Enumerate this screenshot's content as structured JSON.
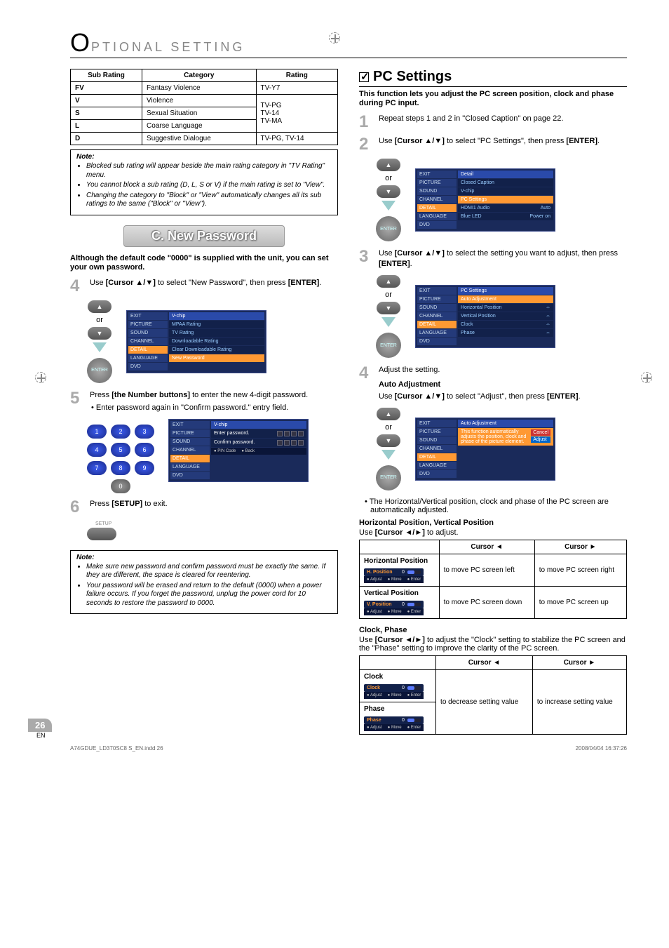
{
  "header": {
    "letter": "O",
    "rest": "PTIONAL SETTING"
  },
  "ratings_table": {
    "headers": [
      "Sub Rating",
      "Category",
      "Rating"
    ],
    "rows": [
      {
        "sub": "FV",
        "cat": "Fantasy Violence",
        "rating": "TV-Y7"
      },
      {
        "sub": "V",
        "cat": "Violence",
        "rating": "TV-PG\nTV-14\nTV-MA"
      },
      {
        "sub": "S",
        "cat": "Sexual Situation",
        "rating": ""
      },
      {
        "sub": "L",
        "cat": "Coarse Language",
        "rating": ""
      },
      {
        "sub": "D",
        "cat": "Suggestive Dialogue",
        "rating": "TV-PG, TV-14"
      }
    ]
  },
  "note1": {
    "title": "Note:",
    "items": [
      "Blocked sub rating will appear beside the main rating category in \"TV Rating\" menu.",
      "You cannot block a sub rating (D, L, S or V) if the main rating is set to \"View\".",
      "Changing the category to \"Block\" or \"View\" automatically changes all its sub ratings to the same (\"Block\" or \"View\")."
    ]
  },
  "banner_c": "C.  New Password",
  "pw_intro": "Although the default code \"0000\" is supplied with the unit, you can set your own password.",
  "step4": {
    "n": "4",
    "t1": "Use ",
    "bold": "[Cursor ▲/▼]",
    "t2": " to select \"New Password\", then press ",
    "bold2": "[ENTER]",
    "t3": "."
  },
  "or": "or",
  "enter": "ENTER",
  "osd_vchip": {
    "side": [
      "EXIT",
      "PICTURE",
      "SOUND",
      "CHANNEL",
      "DETAIL",
      "LANGUAGE",
      "DVD"
    ],
    "title": "V-chip",
    "rows": [
      "MPAA Rating",
      "TV Rating",
      "Downloadable Rating",
      "Clear Downloadable Rating",
      "New Password"
    ]
  },
  "step5": {
    "n": "5",
    "t1": "Press ",
    "bold": "[the Number buttons]",
    "t2": " to enter the new 4-digit password.",
    "sub": "Enter password again in \"Confirm password.\" entry field."
  },
  "osd_pw": {
    "title": "V-chip",
    "rows": [
      {
        "label": "Enter password."
      },
      {
        "label": "Confirm password."
      }
    ],
    "foot": [
      "PIN Code",
      "Back"
    ]
  },
  "step6": {
    "n": "6",
    "t1": "Press ",
    "bold": "[SETUP]",
    "t2": " to exit."
  },
  "setup_lbl": "SETUP",
  "note2": {
    "title": "Note:",
    "items": [
      "Make sure new password and confirm password must be exactly the same. If they are different, the space is cleared for reentering.",
      "Your password will be erased and return to the default (0000) when a power failure occurs. If you forget the password, unplug the power cord for 10 seconds to restore the password to 0000."
    ]
  },
  "pc": {
    "title": "PC Settings",
    "intro": "This function lets you adjust the PC screen position, clock and phase during PC input.",
    "s1": {
      "n": "1",
      "t": "Repeat steps 1 and 2 in \"Closed Caption\" on page 22."
    },
    "s2": {
      "n": "2",
      "t1": "Use ",
      "bold": "[Cursor ▲/▼]",
      "t2": " to select \"PC Settings\", then press ",
      "bold2": "[ENTER]",
      "t3": "."
    },
    "osd_detail": {
      "title": "Detail",
      "rows": [
        {
          "l": "Closed Caption",
          "r": ""
        },
        {
          "l": "V-chip",
          "r": ""
        },
        {
          "l": "PC Settings",
          "r": "",
          "hi": true
        },
        {
          "l": "HDMI1 Audio",
          "r": "Auto"
        },
        {
          "l": "Blue LED",
          "r": "Power on"
        }
      ]
    },
    "s3": {
      "n": "3",
      "t1": "Use ",
      "bold": "[Cursor ▲/▼]",
      "t2": " to select the setting you want to adjust, then press ",
      "bold2": "[ENTER]",
      "t3": "."
    },
    "osd_pcs": {
      "title": "PC Settings",
      "rows": [
        {
          "l": "Auto Adjustment",
          "r": "",
          "hi": true
        },
        {
          "l": "Horizontal Position",
          "r": "⇔"
        },
        {
          "l": "Vertical Position",
          "r": "⇔"
        },
        {
          "l": "Clock",
          "r": "⇔"
        },
        {
          "l": "Phase",
          "r": "⇔"
        }
      ]
    },
    "s4": {
      "n": "4",
      "t": "Adjust the setting.",
      "auto_h": "Auto Adjustment",
      "auto_t1": "Use ",
      "auto_b": "[Cursor ▲/▼]",
      "auto_t2": " to select \"Adjust\", then press ",
      "auto_b2": "[ENTER]",
      "auto_t3": "."
    },
    "osd_auto": {
      "title": "Auto Adjustment",
      "desc": "This function automatically adjusts the position, clock and phase of the picture element.",
      "opts": [
        "Cancel",
        "Adjust"
      ]
    },
    "auto_bullet": "The Horizontal/Vertical position, clock and phase of the PC screen are automatically adjusted.",
    "hv_h": "Horizontal Position, Vertical Position",
    "hv_t1": "Use ",
    "hv_b": "[Cursor ◄/►]",
    "hv_t2": " to adjust.",
    "tbl_hv": {
      "head": [
        "",
        "Cursor ◄",
        "Cursor ►"
      ],
      "r1": {
        "title": "Horizontal Position",
        "lab": "H. Position",
        "c1": "to move PC screen left",
        "c2": "to move PC screen right"
      },
      "r2": {
        "title": "Vertical Position",
        "lab": "V. Position",
        "c1": "to move PC screen down",
        "c2": "to move PC screen up"
      },
      "hint": [
        "Adjust",
        "Move",
        "Enter"
      ]
    },
    "cp_h": "Clock, Phase",
    "cp_t1": "Use ",
    "cp_b": "[Cursor ◄/►]",
    "cp_t2": " to adjust the \"Clock\" setting to stabilize the PC screen and the \"Phase\" setting to improve the clarity of the PC screen.",
    "tbl_cp": {
      "head": [
        "",
        "Cursor ◄",
        "Cursor ►"
      ],
      "r1": {
        "title": "Clock",
        "lab": "Clock"
      },
      "r2": {
        "title": "Phase",
        "lab": "Phase"
      },
      "c1": "to decrease setting value",
      "c2": "to increase setting value",
      "hint": [
        "Adjust",
        "Move",
        "Enter"
      ]
    }
  },
  "page": {
    "num": "26",
    "en": "EN"
  },
  "foot": {
    "file": "A74GDUE_LD370SC8 S_EN.indd   26",
    "ts": "2008/04/04   16:37:26"
  }
}
